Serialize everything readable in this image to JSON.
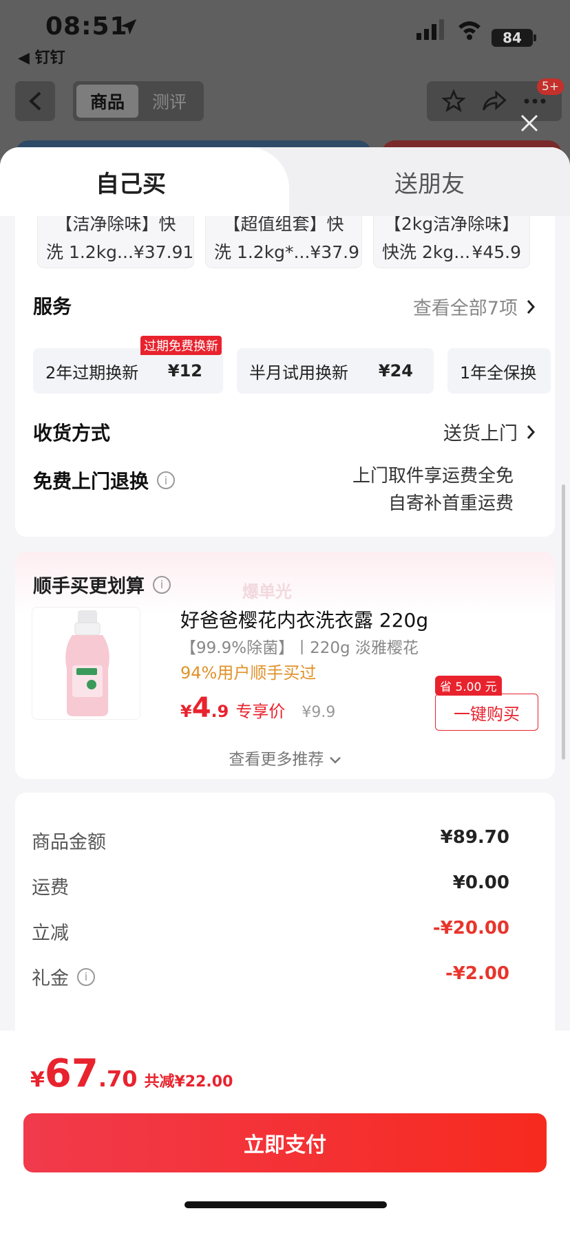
{
  "status_bar": {
    "time": "08:51",
    "back_app": "◀ 钉钉",
    "battery": "84"
  },
  "nav": {
    "tabs": [
      "商品",
      "测评"
    ],
    "badge": "5+"
  },
  "sheet_tabs": {
    "active": "自己买",
    "inactive": "送朋友"
  },
  "variants": [
    {
      "line1": "【洁净除味】快",
      "line2_name": "洗 1.2kg...",
      "price": "¥37.91"
    },
    {
      "line1": "【超值组套】快",
      "line2_name": "洗 1.2kg*...",
      "price": "¥37.9"
    },
    {
      "line1": "【2kg洁净除味】",
      "line2_name": "快洗 2kg...",
      "price": "¥45.9"
    }
  ],
  "service": {
    "title": "服务",
    "view_all": "查看全部7项",
    "items": [
      {
        "name": "2年过期换新",
        "price": "¥12",
        "badge": "过期免费换新"
      },
      {
        "name": "半月试用换新",
        "price": "¥24"
      },
      {
        "name": "1年全保换",
        "price": ""
      }
    ]
  },
  "delivery": {
    "title": "收货方式",
    "value": "送货上门"
  },
  "free_return": {
    "title": "免费上门退换",
    "line1": "上门取件享运费全免",
    "line2": "自寄补首重运费"
  },
  "recommend": {
    "title": "顺手买更划算",
    "watermark": "爆单光",
    "product_name": "好爸爸樱花内衣洗衣露 220g",
    "product_spec": "【99.9%除菌】丨220g 淡雅樱花",
    "bought": "94%用户顺手买过",
    "price_symbol": "¥",
    "price_int": "4",
    "price_dec": ".9",
    "price_tag": "专享价",
    "orig_price": "¥9.9",
    "save_badge": "省 5.00 元",
    "buy_btn": "一键购买",
    "more": "查看更多推荐"
  },
  "price_summary": [
    {
      "label": "商品金额",
      "value": "¥89.70",
      "red": false,
      "info": false
    },
    {
      "label": "运费",
      "value": "¥0.00",
      "red": false,
      "info": false
    },
    {
      "label": "立减",
      "value": "-¥20.00",
      "red": true,
      "info": false
    },
    {
      "label": "礼金",
      "value": "-¥2.00",
      "red": true,
      "info": true
    }
  ],
  "total": {
    "symbol": "¥",
    "int": "67",
    "dec": ".70",
    "saved": "共减¥22.00"
  },
  "pay_button": "立即支付",
  "colors": {
    "accent_red": "#e8232e",
    "orange": "#e0922a"
  }
}
